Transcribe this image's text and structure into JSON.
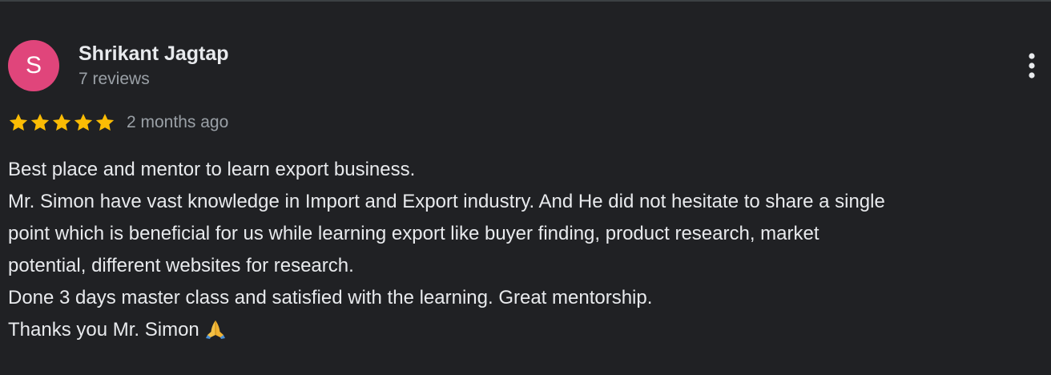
{
  "reviewer": {
    "avatar_initial": "S",
    "avatar_color": "#e0457b",
    "name": "Shrikant Jagtap",
    "review_count": "7 reviews"
  },
  "review": {
    "rating": 5,
    "rating_max": 5,
    "star_color": "#fbbc04",
    "date": "2 months ago",
    "lines": [
      "Best place and mentor to learn export business.",
      "Mr. Simon have vast knowledge in Import and Export industry. And He did not hesitate to share a single",
      "point which is beneficial for us while learning export like buyer finding, product research, market",
      "potential, different websites for research.",
      "Done 3 days master class and satisfied with the learning. Great mentorship.",
      "Thanks you Mr. Simon"
    ],
    "closing_emoji": "folded-hands-emoji"
  },
  "icons": {
    "more_options": "more-vertical-icon",
    "star": "star-icon"
  }
}
